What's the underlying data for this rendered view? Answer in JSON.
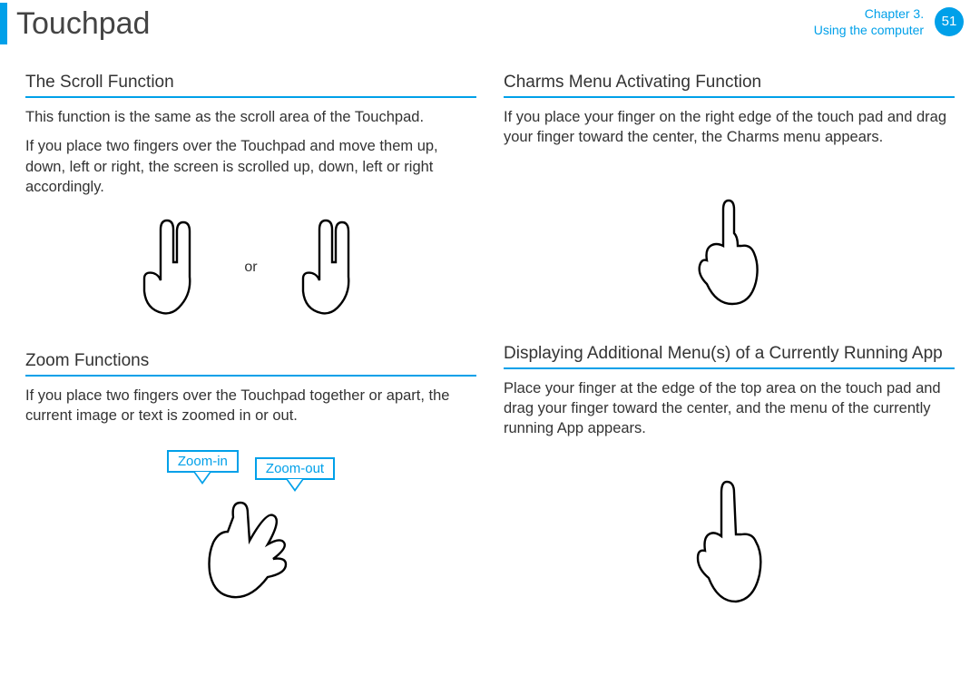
{
  "header": {
    "title": "Touchpad",
    "chapter_line1": "Chapter 3.",
    "chapter_line2": "Using the computer",
    "page_number": "51"
  },
  "sections": {
    "scroll": {
      "heading": "The Scroll Function",
      "p1": "This function is the same as the scroll area of the Touchpad.",
      "p2": "If you place two ﬁngers over the Touchpad and move them up, down, left or right, the screen is scrolled up, down, left or right accordingly.",
      "or_label": "or"
    },
    "zoom": {
      "heading": "Zoom Functions",
      "p1": "If you place two ﬁngers over the Touchpad together or apart, the current image or text is zoomed in or out.",
      "zoom_in_label": "Zoom-in",
      "zoom_out_label": "Zoom-out"
    },
    "charms": {
      "heading": "Charms Menu Activating Function",
      "p1": "If you place your ﬁnger on the right edge of the touch pad and drag your ﬁnger toward the center, the Charms menu appears."
    },
    "app_menu": {
      "heading": "Displaying Additional Menu(s) of a Currently Running App",
      "p1": "Place your ﬁnger at the edge of the top area on the touch pad and drag your ﬁnger toward the center, and the menu of the currently running App appears."
    }
  }
}
